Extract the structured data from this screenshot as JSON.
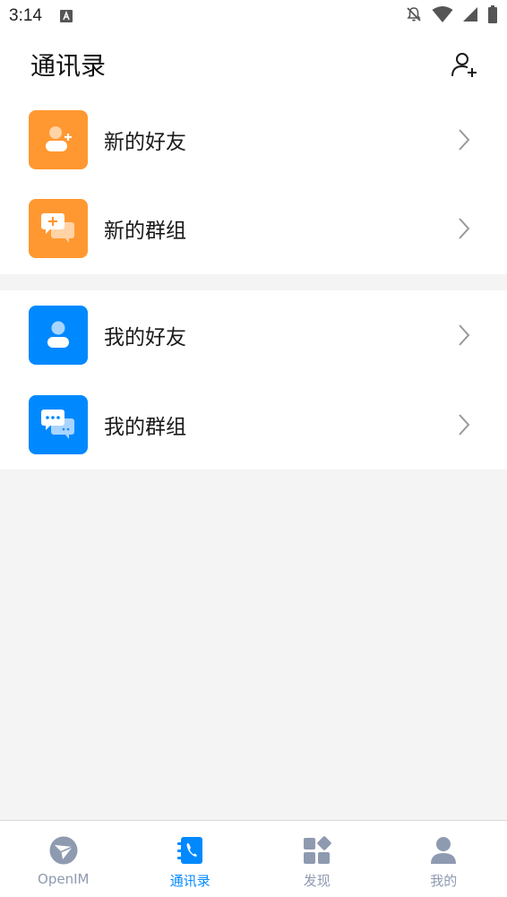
{
  "status_bar": {
    "time": "3:14",
    "icons": [
      "a-notification-icon",
      "notifications-off-icon",
      "wifi-icon",
      "cell-signal-icon",
      "battery-icon"
    ]
  },
  "header": {
    "title": "通讯录",
    "add_icon": "add-contact-icon"
  },
  "sections": [
    {
      "items": [
        {
          "label": "新的好友",
          "icon": "new-friend-icon",
          "color": "#ff9831"
        },
        {
          "label": "新的群组",
          "icon": "new-group-icon",
          "color": "#ff9831"
        }
      ]
    },
    {
      "items": [
        {
          "label": "我的好友",
          "icon": "my-friends-icon",
          "color": "#0089ff"
        },
        {
          "label": "我的群组",
          "icon": "my-groups-icon",
          "color": "#0089ff"
        }
      ]
    }
  ],
  "tabbar": {
    "tabs": [
      {
        "label": "OpenIM",
        "icon": "openim-icon",
        "active": false
      },
      {
        "label": "通讯录",
        "icon": "contacts-icon",
        "active": true
      },
      {
        "label": "发现",
        "icon": "discover-icon",
        "active": false
      },
      {
        "label": "我的",
        "icon": "profile-icon",
        "active": false
      }
    ]
  },
  "colors": {
    "accent": "#0089ff",
    "orange": "#ff9831",
    "inactive_tab": "#8e9ab0",
    "background": "#f4f4f4"
  }
}
